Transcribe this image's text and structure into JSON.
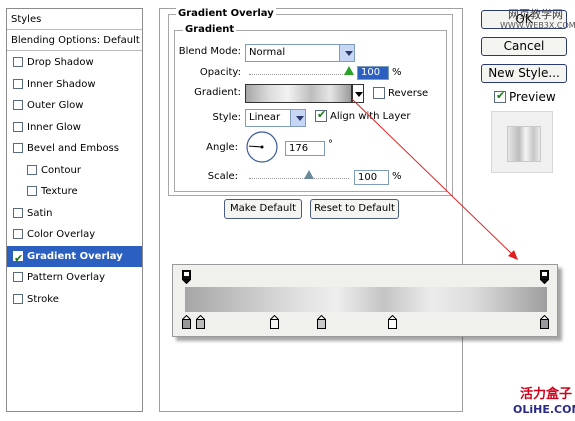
{
  "styles_list": {
    "header": "Styles",
    "blending_options": "Blending Options: Default",
    "items": [
      {
        "label": "Drop Shadow",
        "checked": false,
        "indent": false
      },
      {
        "label": "Inner Shadow",
        "checked": false,
        "indent": false
      },
      {
        "label": "Outer Glow",
        "checked": false,
        "indent": false
      },
      {
        "label": "Inner Glow",
        "checked": false,
        "indent": false
      },
      {
        "label": "Bevel and Emboss",
        "checked": false,
        "indent": false
      },
      {
        "label": "Contour",
        "checked": false,
        "indent": true
      },
      {
        "label": "Texture",
        "checked": false,
        "indent": true
      },
      {
        "label": "Satin",
        "checked": false,
        "indent": false
      },
      {
        "label": "Color Overlay",
        "checked": false,
        "indent": false
      },
      {
        "label": "Gradient Overlay",
        "checked": true,
        "indent": false,
        "selected": true
      },
      {
        "label": "Pattern Overlay",
        "checked": false,
        "indent": false
      },
      {
        "label": "Stroke",
        "checked": false,
        "indent": false
      }
    ]
  },
  "panel": {
    "title": "Gradient Overlay",
    "group_title": "Gradient",
    "blend_mode_label": "Blend Mode:",
    "blend_mode_value": "Normal",
    "opacity_label": "Opacity:",
    "opacity_value": "100",
    "opacity_unit": "%",
    "opacity_level": 1.0,
    "gradient_label": "Gradient:",
    "reverse_label": "Reverse",
    "reverse_checked": false,
    "style_label": "Style:",
    "style_value": "Linear",
    "align_label": "Align with Layer",
    "align_checked": true,
    "angle_label": "Angle:",
    "angle_value": "176",
    "angle_unit": "°",
    "angle_degrees": 176,
    "scale_label": "Scale:",
    "scale_value": "100",
    "scale_unit": "%",
    "scale_level": 0.5,
    "make_default": "Make Default",
    "reset_default": "Reset to Default"
  },
  "right_buttons": {
    "ok": "OK",
    "cancel": "Cancel",
    "new_style": "New Style...",
    "preview_label": "Preview",
    "preview_checked": true
  },
  "watermarks": {
    "top_cn": "网页教学网",
    "top_url": "WWW.WEB3X.COM",
    "bottom_cn": "活力盒子",
    "bottom_url": "OLiHE.COM"
  },
  "colors": {
    "selection": "#2b5fc0",
    "accent_arrow": "#e02020"
  }
}
